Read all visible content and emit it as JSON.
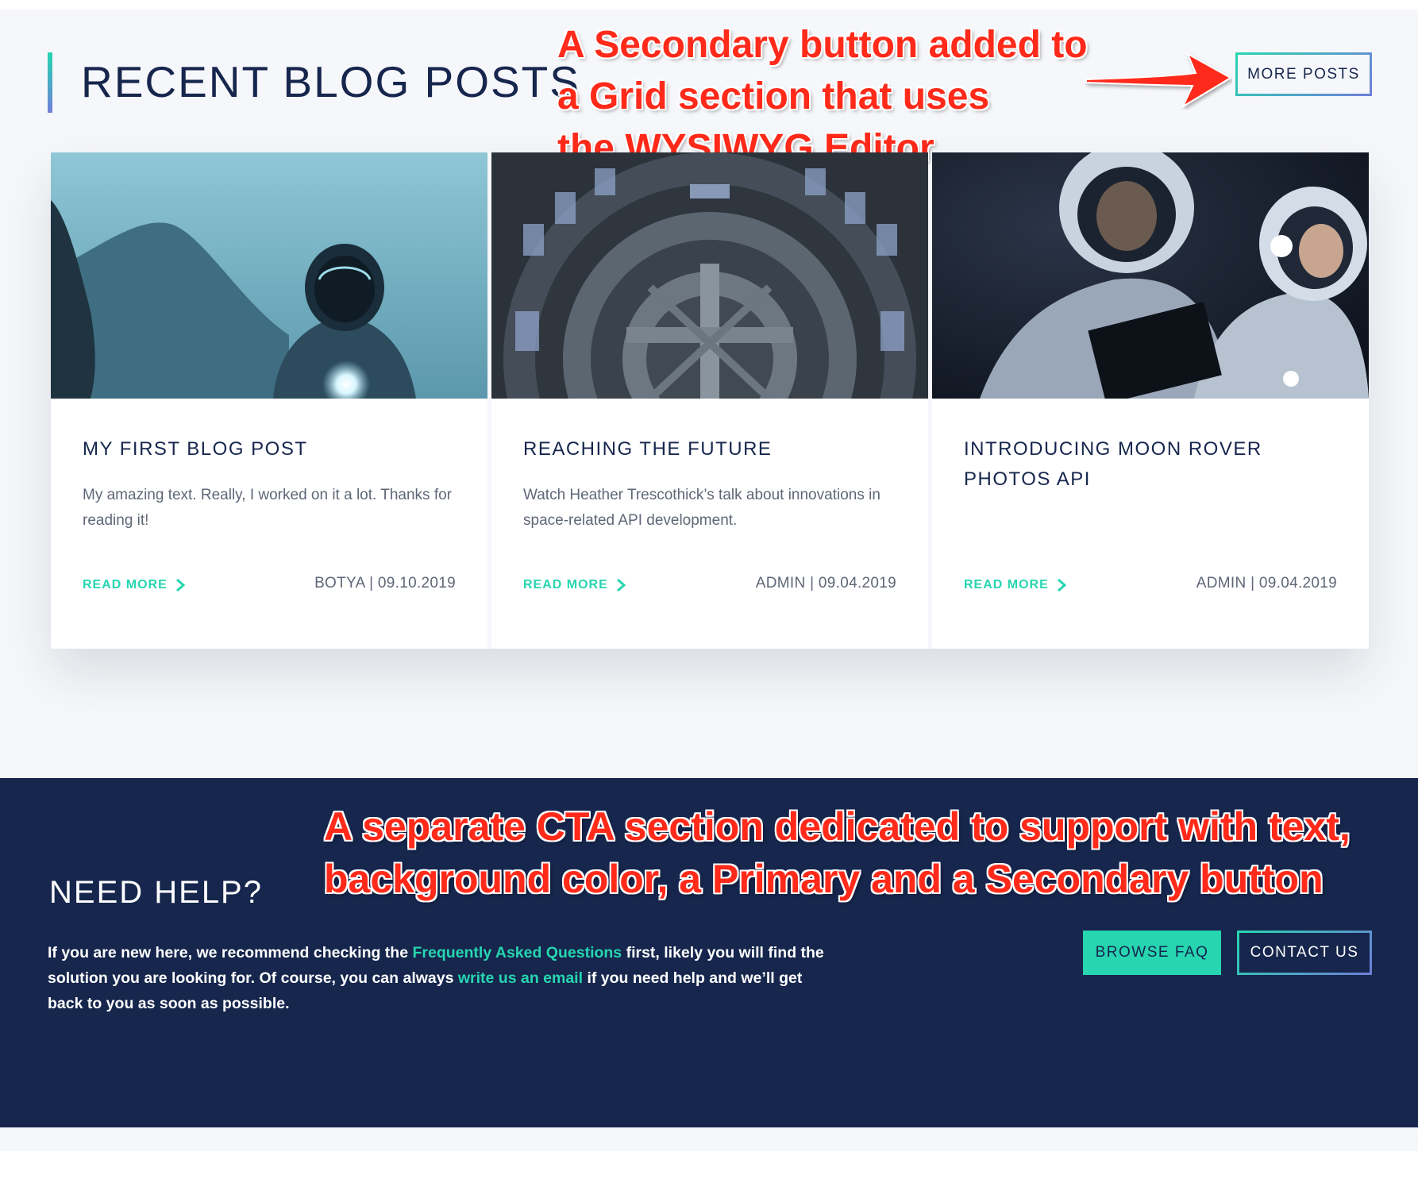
{
  "header": {
    "title": "RECENT BLOG POSTS",
    "more_posts_label": "MORE POSTS"
  },
  "annotations": {
    "top": [
      "A Secondary button added to",
      "a Grid section that uses",
      "the WYSIWYG Editor"
    ],
    "cta": [
      "A separate CTA section dedicated to support with text,",
      "background color, a Primary and a Secondary button"
    ]
  },
  "posts": [
    {
      "title": "MY FIRST BLOG POST",
      "excerpt": "My amazing text. Really, I worked on it a lot. Thanks for reading it!",
      "read_more": "READ MORE",
      "meta": "BOTYA | 09.10.2019"
    },
    {
      "title": "REACHING THE FUTURE",
      "excerpt": "Watch Heather Trescothick’s talk about innovations in space-related API development.",
      "read_more": "READ MORE",
      "meta": "ADMIN | 09.04.2019"
    },
    {
      "title": "INTRODUCING MOON ROVER PHOTOS API",
      "excerpt": "",
      "read_more": "READ MORE",
      "meta": "ADMIN | 09.04.2019"
    }
  ],
  "cta": {
    "title": "NEED HELP?",
    "text_1": "If you are new here, we recommend checking the ",
    "link_faq": "Frequently Asked Questions",
    "text_2": " first, likely you will find the solution you are looking for. Of course, you can always ",
    "link_email": "write us an email",
    "text_3": " if you need help and we’ll get back to you as soon as possible.",
    "primary_label": "BROWSE FAQ",
    "secondary_label": "CONTACT US"
  },
  "colors": {
    "navy": "#16264d",
    "accent": "#27d5b0",
    "accent_2": "#6f7fd8",
    "annotation": "#ff2a1a"
  }
}
